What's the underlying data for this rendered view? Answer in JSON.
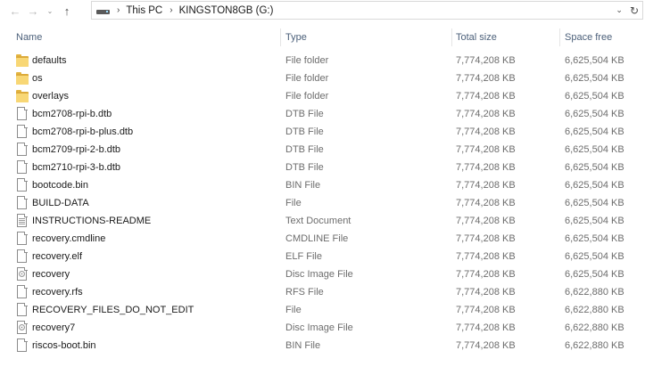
{
  "nav": {
    "back_glyph": "←",
    "forward_glyph": "→",
    "recent_glyph": "⌄",
    "up_glyph": "↑"
  },
  "address": {
    "separator": "›",
    "crumbs": [
      "This PC",
      "KINGSTON8GB (G:)"
    ],
    "dropdown_glyph": "⌄",
    "refresh_glyph": "↻"
  },
  "columns": {
    "name": "Name",
    "type": "Type",
    "total_size": "Total size",
    "space_free": "Space free"
  },
  "rows": [
    {
      "icon": "folder",
      "name": "defaults",
      "type": "File folder",
      "total": "7,774,208 KB",
      "free": "6,625,504 KB"
    },
    {
      "icon": "folder",
      "name": "os",
      "type": "File folder",
      "total": "7,774,208 KB",
      "free": "6,625,504 KB"
    },
    {
      "icon": "folder",
      "name": "overlays",
      "type": "File folder",
      "total": "7,774,208 KB",
      "free": "6,625,504 KB"
    },
    {
      "icon": "file",
      "name": "bcm2708-rpi-b.dtb",
      "type": "DTB File",
      "total": "7,774,208 KB",
      "free": "6,625,504 KB"
    },
    {
      "icon": "file",
      "name": "bcm2708-rpi-b-plus.dtb",
      "type": "DTB File",
      "total": "7,774,208 KB",
      "free": "6,625,504 KB"
    },
    {
      "icon": "file",
      "name": "bcm2709-rpi-2-b.dtb",
      "type": "DTB File",
      "total": "7,774,208 KB",
      "free": "6,625,504 KB"
    },
    {
      "icon": "file",
      "name": "bcm2710-rpi-3-b.dtb",
      "type": "DTB File",
      "total": "7,774,208 KB",
      "free": "6,625,504 KB"
    },
    {
      "icon": "file",
      "name": "bootcode.bin",
      "type": "BIN File",
      "total": "7,774,208 KB",
      "free": "6,625,504 KB"
    },
    {
      "icon": "file",
      "name": "BUILD-DATA",
      "type": "File",
      "total": "7,774,208 KB",
      "free": "6,625,504 KB"
    },
    {
      "icon": "textdoc",
      "name": "INSTRUCTIONS-README",
      "type": "Text Document",
      "total": "7,774,208 KB",
      "free": "6,625,504 KB"
    },
    {
      "icon": "file",
      "name": "recovery.cmdline",
      "type": "CMDLINE File",
      "total": "7,774,208 KB",
      "free": "6,625,504 KB"
    },
    {
      "icon": "file",
      "name": "recovery.elf",
      "type": "ELF File",
      "total": "7,774,208 KB",
      "free": "6,625,504 KB"
    },
    {
      "icon": "disc",
      "name": "recovery",
      "type": "Disc Image File",
      "total": "7,774,208 KB",
      "free": "6,625,504 KB"
    },
    {
      "icon": "file",
      "name": "recovery.rfs",
      "type": "RFS File",
      "total": "7,774,208 KB",
      "free": "6,622,880 KB"
    },
    {
      "icon": "file",
      "name": "RECOVERY_FILES_DO_NOT_EDIT",
      "type": "File",
      "total": "7,774,208 KB",
      "free": "6,622,880 KB"
    },
    {
      "icon": "disc",
      "name": "recovery7",
      "type": "Disc Image File",
      "total": "7,774,208 KB",
      "free": "6,622,880 KB"
    },
    {
      "icon": "file",
      "name": "riscos-boot.bin",
      "type": "BIN File",
      "total": "7,774,208 KB",
      "free": "6,622,880 KB"
    }
  ]
}
